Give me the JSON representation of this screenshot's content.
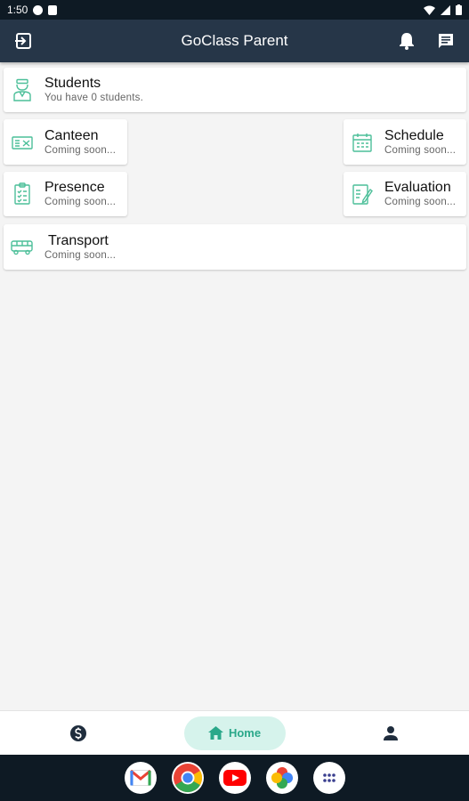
{
  "status_bar": {
    "time": "1:50"
  },
  "app_bar": {
    "title": "GoClass Parent"
  },
  "cards": {
    "students": {
      "title": "Students",
      "subtitle": "You have 0 students."
    },
    "canteen": {
      "title": "Canteen",
      "subtitle": "Coming soon..."
    },
    "schedule": {
      "title": "Schedule",
      "subtitle": "Coming soon..."
    },
    "presence": {
      "title": "Presence",
      "subtitle": "Coming soon..."
    },
    "evaluation": {
      "title": "Evaluation",
      "subtitle": "Coming soon..."
    },
    "transport": {
      "title": "Transport",
      "subtitle": "Coming soon..."
    }
  },
  "bottom_nav": {
    "home_label": "Home"
  },
  "colors": {
    "app_bar": "#263648",
    "accent": "#2aa88a",
    "icon_green": "#4cbf99"
  },
  "icons": [
    "logout-icon",
    "bell-icon",
    "message-icon",
    "student-icon",
    "canteen-icon",
    "schedule-icon",
    "presence-icon",
    "evaluation-icon",
    "bus-icon",
    "dollar-icon",
    "home-icon",
    "person-icon"
  ]
}
